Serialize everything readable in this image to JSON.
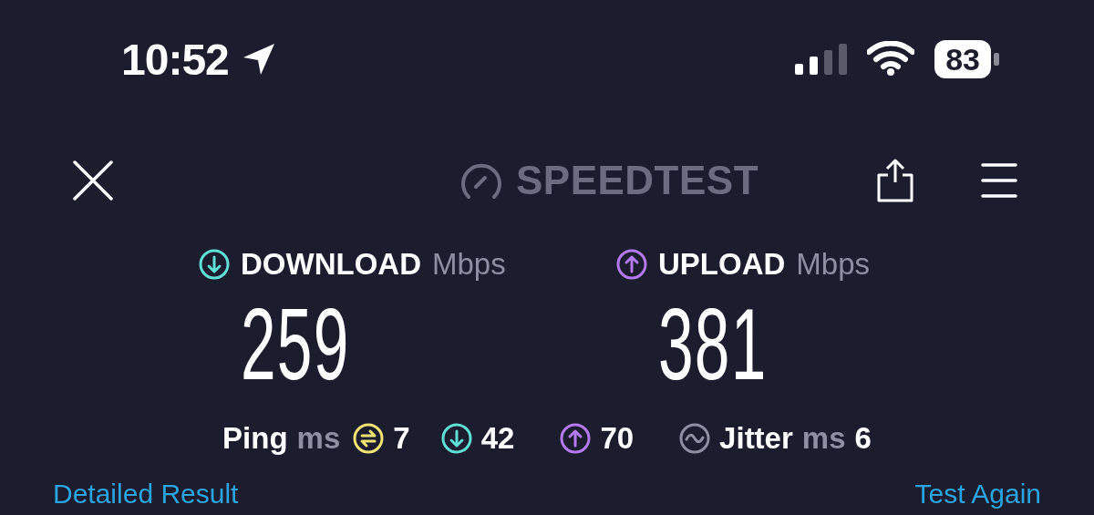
{
  "status_bar": {
    "time": "10:52",
    "battery": "83"
  },
  "header": {
    "logo": "SPEEDTEST"
  },
  "results": [
    {
      "kind": "download",
      "label": "DOWNLOAD",
      "unit": "Mbps",
      "value": "259",
      "color": "#5fe0d6"
    },
    {
      "kind": "upload",
      "label": "UPLOAD",
      "unit": "Mbps",
      "value": "381",
      "color": "#b57af0"
    }
  ],
  "ping": {
    "label": "Ping",
    "unit": "ms",
    "items": [
      {
        "kind": "idle",
        "value": "7",
        "color": "#f1e373"
      },
      {
        "kind": "download",
        "value": "42",
        "color": "#5fe0d6"
      },
      {
        "kind": "upload",
        "value": "70",
        "color": "#b57af0"
      }
    ]
  },
  "jitter": {
    "label": "Jitter",
    "unit": "ms",
    "value": "6"
  },
  "links": [
    "Detailed Result",
    "Test Again"
  ]
}
